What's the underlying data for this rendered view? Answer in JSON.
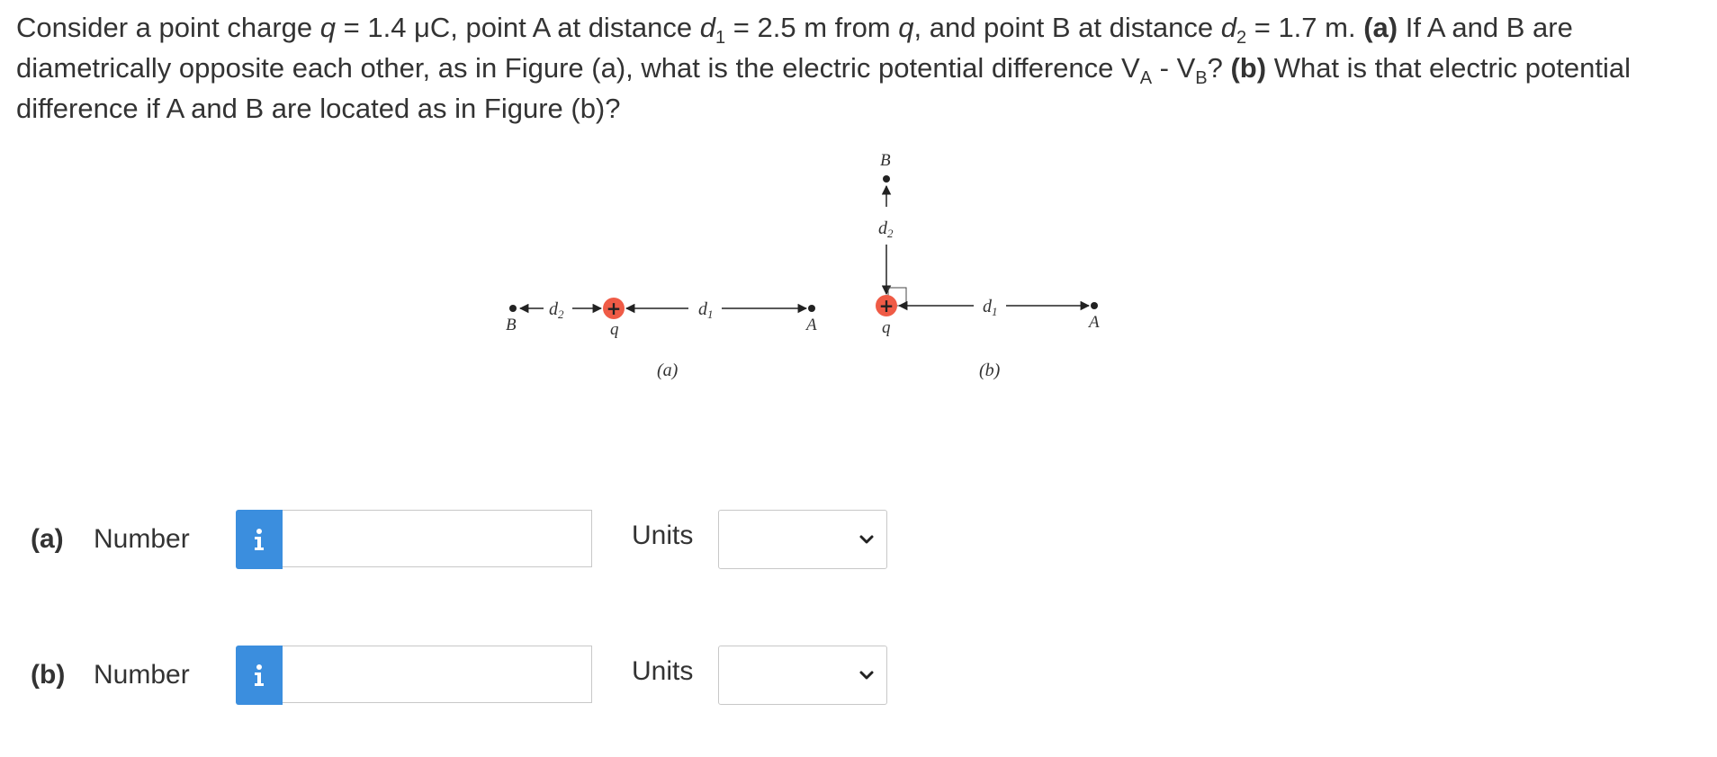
{
  "question": {
    "t1": "Consider a point charge ",
    "q_sym": "q",
    "t2": " = 1.4 μC, point A at distance ",
    "d1_sym": "d",
    "d1_sub": "1",
    "t3": " = 2.5 m from ",
    "q_sym2": "q",
    "t4": ", and point B at distance ",
    "d2_sym": "d",
    "d2_sub": "2",
    "t5": " = 1.7 m. ",
    "part_a_tag": "(a)",
    "t6": " If A and B are diametrically opposite each other, as in Figure (a), what is the electric potential difference V",
    "va_sub": "A",
    "t7": " - V",
    "vb_sub": "B",
    "t8": "? ",
    "part_b_tag": "(b)",
    "t9": " What is that electric potential difference if A and B are located as in Figure (b)?"
  },
  "figure": {
    "a": {
      "label_B": "B",
      "label_q": "q",
      "label_A": "A",
      "label_d2": "d",
      "label_d2_sub": "2",
      "label_d1": "d",
      "label_d1_sub": "1",
      "caption": "(a)",
      "charge_sign": "+"
    },
    "b": {
      "label_B": "B",
      "label_q": "q",
      "label_A": "A",
      "label_d2": "d",
      "label_d2_sub": "2",
      "label_d1": "d",
      "label_d1_sub": "1",
      "caption": "(b)",
      "charge_sign": "+"
    }
  },
  "answers": [
    {
      "part": "(a)",
      "number_label": "Number",
      "info_icon": "i",
      "value": "",
      "units_label": "Units",
      "units_selected": ""
    },
    {
      "part": "(b)",
      "number_label": "Number",
      "info_icon": "i",
      "value": "",
      "units_label": "Units",
      "units_selected": ""
    }
  ],
  "colors": {
    "info_button": "#3b8ede",
    "charge_fill": "#ef5b46",
    "text": "#333333"
  },
  "icons": {
    "info": "info-icon",
    "dropdown": "chevron-down-icon",
    "charge": "positive-charge-icon"
  }
}
